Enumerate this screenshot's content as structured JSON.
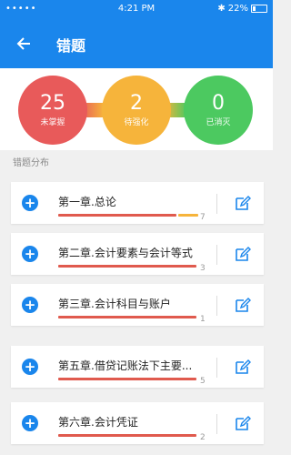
{
  "status_bar": {
    "carrier": "•••••",
    "time": "4:21 PM",
    "battery": "22%"
  },
  "app_bar": {
    "title": "错题"
  },
  "summary": [
    {
      "value": "25",
      "label": "未掌握",
      "color": "#e85a5a"
    },
    {
      "value": "2",
      "label": "待强化",
      "color": "#f6b43b"
    },
    {
      "value": "0",
      "label": "已消灭",
      "color": "#4cc960"
    }
  ],
  "section_title": "错题分布",
  "chapters": [
    {
      "name": "第一章.总论",
      "count": "7",
      "progress_red": 0.81,
      "progress_orange": 0.14
    },
    {
      "name": "第二章.会计要素与会计等式",
      "count": "3",
      "progress_red": 0.95
    },
    {
      "name": "第三章.会计科目与账户",
      "count": "1",
      "progress_red": 0.95
    },
    {
      "name": "第五章.借贷记账法下主要...",
      "count": "5",
      "progress_red": 0.95
    },
    {
      "name": "第六章.会计凭证",
      "count": "2",
      "progress_red": 0.95
    }
  ],
  "colors": {
    "primary": "#1a86ec",
    "bar_red": "#e05a4e",
    "bar_orange": "#f6b43b"
  }
}
